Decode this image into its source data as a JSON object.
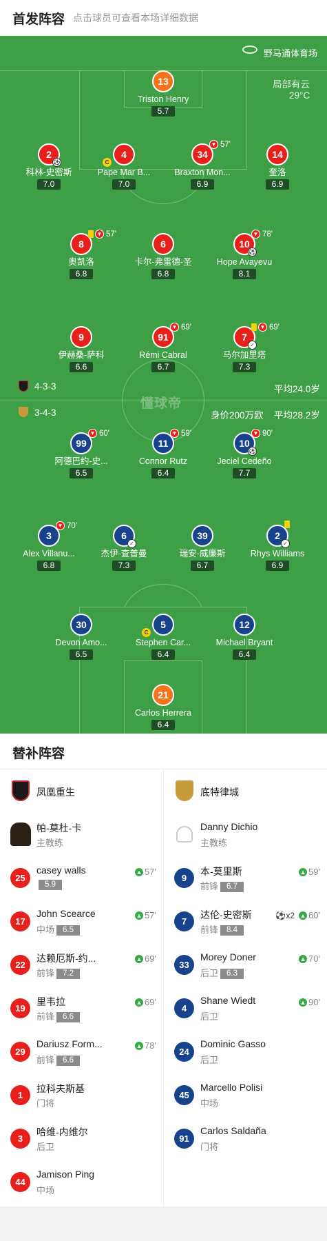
{
  "header": {
    "title": "首发阵容",
    "subtitle": "点击球员可查看本场详细数据"
  },
  "venue": "野马通体育场",
  "weather": {
    "desc": "局部有云",
    "temp": "29°C"
  },
  "watermark": "懂球帝",
  "home": {
    "formation": "4-3-3",
    "avg_age": "平均24.0岁",
    "players": [
      {
        "num": "13",
        "name": "Triston Henry",
        "rating": "5.7"
      },
      {
        "num": "2",
        "name": "科林-史密斯",
        "rating": "7.0"
      },
      {
        "num": "4",
        "name": "Pape Mar B...",
        "rating": "7.0"
      },
      {
        "num": "34",
        "name": "Braxton Mon...",
        "rating": "6.9",
        "sub_time": "57'"
      },
      {
        "num": "14",
        "name": "奎洛",
        "rating": "6.9"
      },
      {
        "num": "8",
        "name": "奥凯洛",
        "rating": "6.8",
        "sub_time": "57'"
      },
      {
        "num": "6",
        "name": "卡尔-弗雷德-圣",
        "rating": "6.8"
      },
      {
        "num": "10",
        "name": "Hope Avayevu",
        "rating": "8.1",
        "sub_time": "78'"
      },
      {
        "num": "9",
        "name": "伊赫桑-萨科",
        "rating": "6.6"
      },
      {
        "num": "91",
        "name": "Rémi Cabral",
        "rating": "6.7",
        "sub_time": "69'"
      },
      {
        "num": "7",
        "name": "马尔加里塔",
        "rating": "7.3",
        "sub_time": "69'"
      }
    ]
  },
  "away": {
    "formation": "3-4-3",
    "value": "身价200万欧",
    "avg_age": "平均28.2岁",
    "players": [
      {
        "num": "99",
        "name": "阿德巴约-史...",
        "rating": "6.5",
        "sub_time": "60'"
      },
      {
        "num": "11",
        "name": "Connor Rutz",
        "rating": "6.4",
        "sub_time": "59'"
      },
      {
        "num": "10",
        "name": "Jeciel Cedeño",
        "rating": "7.7",
        "sub_time": "90'"
      },
      {
        "num": "3",
        "name": "Alex Villanu...",
        "rating": "6.8",
        "sub_time": "70'"
      },
      {
        "num": "6",
        "name": "杰伊-查普曼",
        "rating": "7.3"
      },
      {
        "num": "39",
        "name": "瑞安-威廉斯",
        "rating": "6.7"
      },
      {
        "num": "2",
        "name": "Rhys Williams",
        "rating": "6.9"
      },
      {
        "num": "30",
        "name": "Devon Amo...",
        "rating": "6.5"
      },
      {
        "num": "5",
        "name": "Stephen Car...",
        "rating": "6.4"
      },
      {
        "num": "12",
        "name": "Michael Bryant",
        "rating": "6.4"
      },
      {
        "num": "21",
        "name": "Carlos Herrera",
        "rating": "6.4"
      }
    ]
  },
  "subs": {
    "title": "替补阵容",
    "home": {
      "team": "凤凰重生",
      "coach": {
        "name": "帕-莫杜-卡",
        "role": "主教练"
      },
      "players": [
        {
          "num": "25",
          "name": "casey walls",
          "pos": "",
          "rating": "5.9",
          "time": "57'"
        },
        {
          "num": "17",
          "name": "John Scearce",
          "pos": "中场",
          "rating": "6.5",
          "time": "57'"
        },
        {
          "num": "22",
          "name": "达赖厄斯-约...",
          "pos": "前锋",
          "rating": "7.2",
          "time": "69'"
        },
        {
          "num": "19",
          "name": "里韦拉",
          "pos": "前锋",
          "rating": "6.6",
          "time": "69'"
        },
        {
          "num": "29",
          "name": "Dariusz Form...",
          "pos": "前锋",
          "rating": "6.6",
          "time": "78'"
        },
        {
          "num": "1",
          "name": "拉科夫斯基",
          "pos": "门将"
        },
        {
          "num": "3",
          "name": "哈维-内维尔",
          "pos": "后卫"
        },
        {
          "num": "44",
          "name": "Jamison Ping",
          "pos": "中场"
        }
      ]
    },
    "away": {
      "team": "底特律城",
      "coach": {
        "name": "Danny Dichio",
        "role": "主教练"
      },
      "players": [
        {
          "num": "9",
          "name": "本-莫里斯",
          "pos": "前锋",
          "rating": "6.7",
          "time": "59'"
        },
        {
          "num": "7",
          "name": "达伦-史密斯",
          "pos": "前锋",
          "rating": "8.4",
          "time": "60'",
          "goals": "x2"
        },
        {
          "num": "33",
          "name": "Morey Doner",
          "pos": "后卫",
          "rating": "6.3",
          "time": "70'"
        },
        {
          "num": "4",
          "name": "Shane Wiedt",
          "pos": "后卫",
          "time": "90'"
        },
        {
          "num": "24",
          "name": "Dominic Gasso",
          "pos": "后卫"
        },
        {
          "num": "45",
          "name": "Marcello Polisi",
          "pos": "中场"
        },
        {
          "num": "91",
          "name": "Carlos Saldaña",
          "pos": "门将"
        }
      ]
    }
  }
}
